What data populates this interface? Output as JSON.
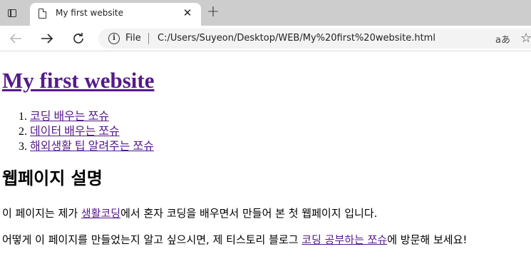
{
  "browser": {
    "tab": {
      "title": "My first website"
    },
    "address": {
      "scheme_label": "File",
      "url": "C:/Users/Suyeon/Desktop/WEB/My%20first%20website.html",
      "read_aloud_label": "aあ"
    }
  },
  "page": {
    "heading": "My first website",
    "list": [
      "코딩 배우는 쪼슈",
      "데이터 배우는 쪼슈",
      "해외생활 팁 알려주는 쪼슈"
    ],
    "section_title": "웹페이지 설명",
    "p1": {
      "before": "이 페이지는 제가 ",
      "link": "생활코딩",
      "after": "에서 혼자 코딩을 배우면서 만들어 본 첫 웹페이지 입니다."
    },
    "p2": {
      "before": "어떻게 이 페이지를 만들었는지 알고 싶으시면, 제 티스토리 블로그 ",
      "link": "코딩 공부하는 쪼슈",
      "after": "에 방문해 보세요!"
    }
  },
  "colors": {
    "visited_link": "#551a8b",
    "tabstrip_bg": "#cdcdcd",
    "omnibox_bg": "#f3f3f3"
  },
  "icons": {
    "tab_actions": "tab-actions-icon",
    "page": "page-icon",
    "close": "close-icon",
    "new_tab": "plus-icon",
    "back": "back-arrow-icon",
    "forward": "forward-arrow-icon",
    "refresh": "refresh-icon",
    "info": "info-icon",
    "favorite": "star-icon"
  }
}
